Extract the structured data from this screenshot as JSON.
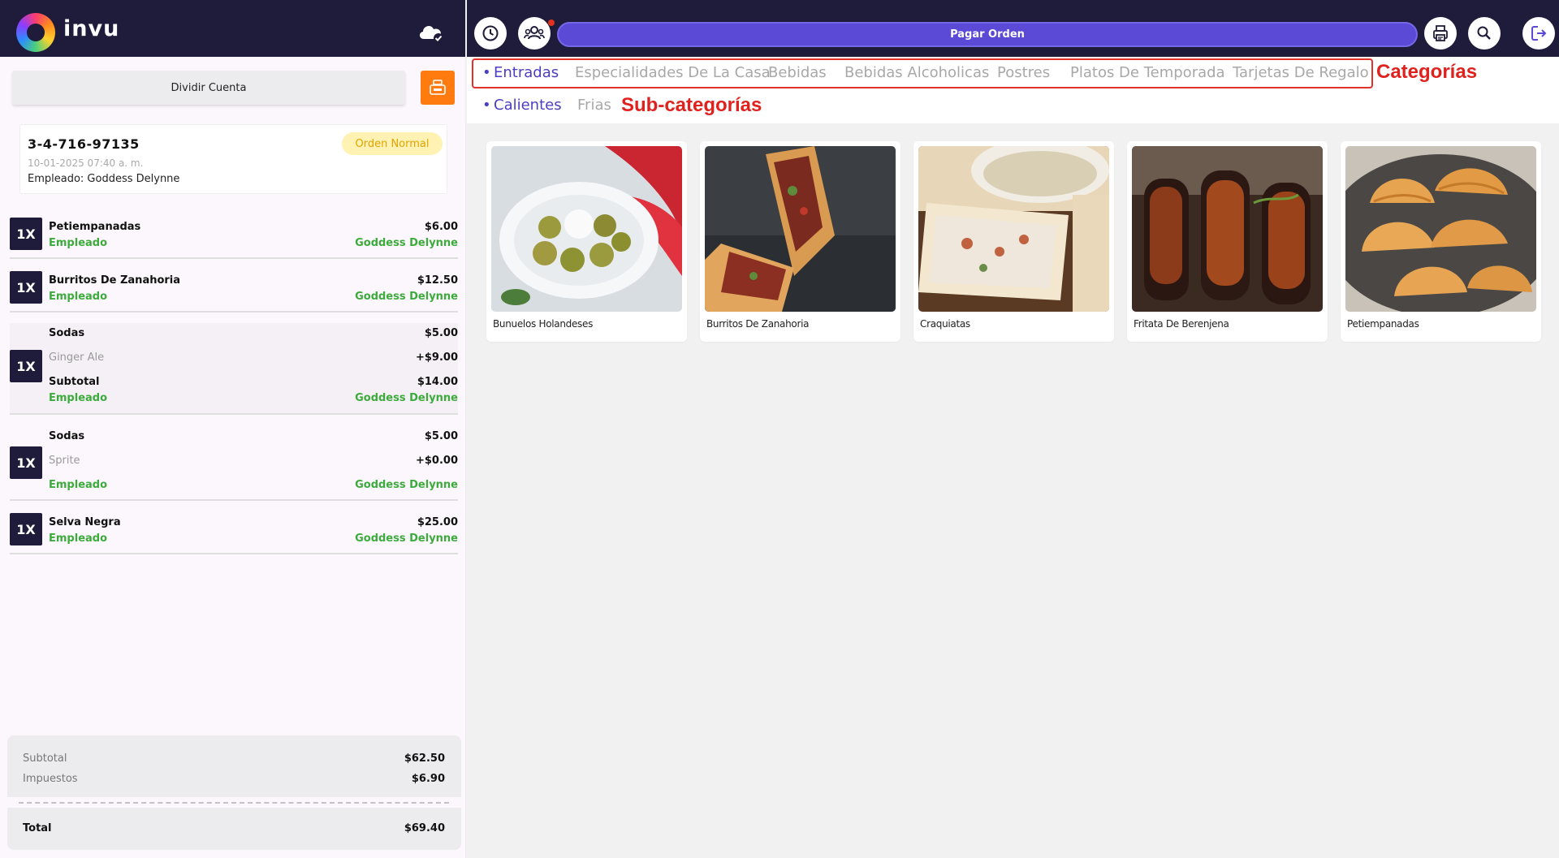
{
  "app": {
    "logo_text": "invu"
  },
  "toolbar": {
    "pay_label": "Pagar Orden"
  },
  "left": {
    "split_label": "Dividir Cuenta",
    "order": {
      "number": "3-4-716-97135",
      "date": "10-01-2025 07:40 a. m.",
      "employee_line": "Empleado: Goddess Delynne",
      "badge": "Orden Normal"
    },
    "items": [
      {
        "qty": "1X",
        "name": "Petiempanadas",
        "price": "$6.00",
        "emp_label": "Empleado",
        "emp_name": "Goddess Delynne"
      },
      {
        "qty": "1X",
        "name": "Burritos De Zanahoria",
        "price": "$12.50",
        "emp_label": "Empleado",
        "emp_name": "Goddess Delynne"
      },
      {
        "qty": "1X",
        "name": "Sodas",
        "price": "$5.00",
        "modifier": "Ginger Ale",
        "modifier_price": "+$9.00",
        "subtotal_label": "Subtotal",
        "subtotal": "$14.00",
        "emp_label": "Empleado",
        "emp_name": "Goddess Delynne"
      },
      {
        "qty": "1X",
        "name": "Sodas",
        "price": "$5.00",
        "modifier": "Sprite",
        "modifier_price": "+$0.00",
        "emp_label": "Empleado",
        "emp_name": "Goddess Delynne"
      },
      {
        "qty": "1X",
        "name": "Selva Negra",
        "price": "$25.00",
        "emp_label": "Empleado",
        "emp_name": "Goddess Delynne"
      }
    ],
    "totals": {
      "subtotal_label": "Subtotal",
      "subtotal": "$62.50",
      "tax_label": "Impuestos",
      "tax": "$6.90",
      "total_label": "Total",
      "total": "$69.40"
    }
  },
  "categories": [
    {
      "label": "Entradas",
      "active": true
    },
    {
      "label": "Especialidades De La Casa",
      "active": false
    },
    {
      "label": "Bebidas",
      "active": false
    },
    {
      "label": "Bebidas Alcoholicas",
      "active": false
    },
    {
      "label": "Postres",
      "active": false
    },
    {
      "label": "Platos De Temporada",
      "active": false
    },
    {
      "label": "Tarjetas De Regalo",
      "active": false
    }
  ],
  "subcategories": [
    {
      "label": "Calientes",
      "active": true
    },
    {
      "label": "Frias",
      "active": false
    }
  ],
  "annotations": {
    "categories": "Categorías",
    "subcategories": "Sub-categorías"
  },
  "products": [
    {
      "name": "Bunuelos Holandeses"
    },
    {
      "name": "Burritos De Zanahoria"
    },
    {
      "name": "Craquiatas"
    },
    {
      "name": "Fritata De Berenjena"
    },
    {
      "name": "Petiempanadas"
    }
  ],
  "colors": {
    "header_bg": "#1f1b3a",
    "accent": "#5a4ad6",
    "employee_green": "#3cab3c",
    "register_orange": "#ff7a0f",
    "callout_red": "#e0221e"
  }
}
